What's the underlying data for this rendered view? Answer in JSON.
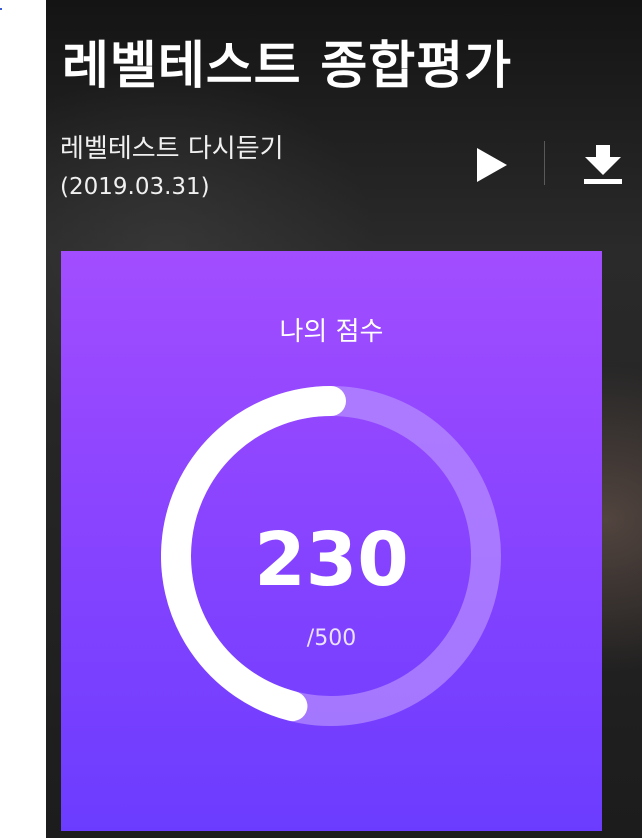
{
  "header": {
    "title": "레벨테스트 종합평가",
    "subtitle": "레벨테스트 다시듣기",
    "date": "(2019.03.31)"
  },
  "actions": {
    "play_icon": "play-icon",
    "download_icon": "download-icon"
  },
  "score": {
    "label": "나의 점수",
    "value": "230",
    "max_label": "/500",
    "progress_fraction": 0.46
  },
  "colors": {
    "card_top": "#a24dff",
    "card_bottom": "#6b3cff",
    "ring_track": "#b48bff",
    "ring_fill": "#ffffff"
  }
}
